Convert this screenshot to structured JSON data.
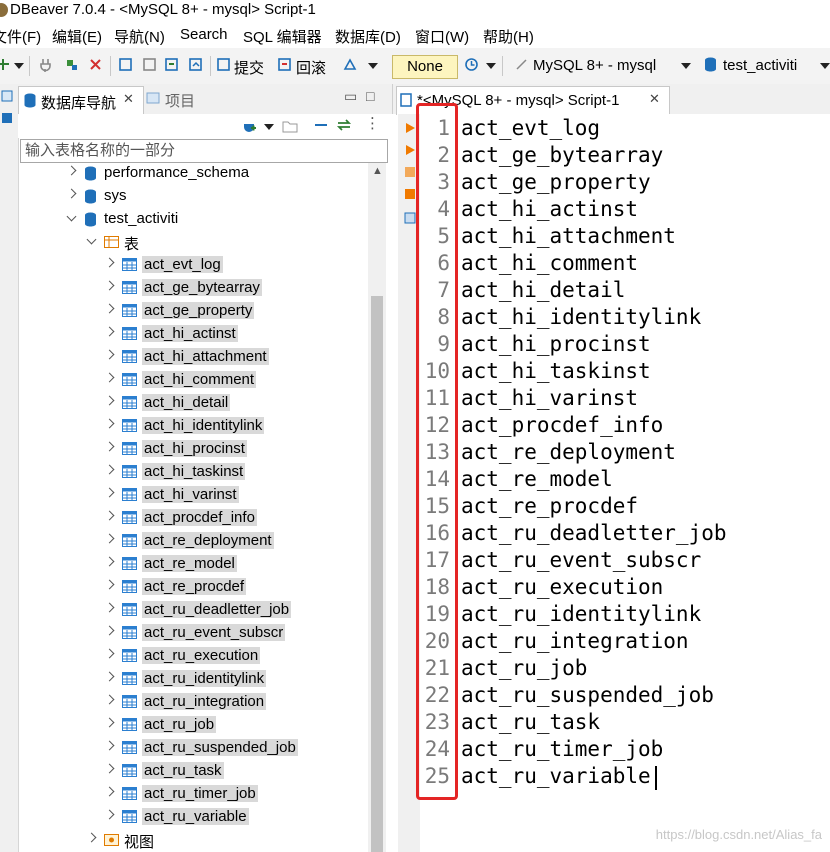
{
  "window": {
    "title": "DBeaver 7.0.4 - <MySQL 8+ - mysql> Script-1"
  },
  "menu": [
    "文件(F)",
    "编辑(E)",
    "导航(N)",
    "Search",
    "SQL 编辑器",
    "数据库(D)",
    "窗口(W)",
    "帮助(H)"
  ],
  "toolbar": {
    "commit_label": "提交",
    "rollback_label": "回滚",
    "transaction_mode": "None",
    "connection": "MySQL 8+ - mysql",
    "schema": "test_activiti"
  },
  "navigator": {
    "tab_active": "数据库导航",
    "tab_inactive": "项目",
    "filter_placeholder": "输入表格名称的一部分",
    "schemas": [
      "performance_schema",
      "sys",
      "test_activiti"
    ],
    "tables_folder": "表",
    "tables": [
      "act_evt_log",
      "act_ge_bytearray",
      "act_ge_property",
      "act_hi_actinst",
      "act_hi_attachment",
      "act_hi_comment",
      "act_hi_detail",
      "act_hi_identitylink",
      "act_hi_procinst",
      "act_hi_taskinst",
      "act_hi_varinst",
      "act_procdef_info",
      "act_re_deployment",
      "act_re_model",
      "act_re_procdef",
      "act_ru_deadletter_job",
      "act_ru_event_subscr",
      "act_ru_execution",
      "act_ru_identitylink",
      "act_ru_integration",
      "act_ru_job",
      "act_ru_suspended_job",
      "act_ru_task",
      "act_ru_timer_job",
      "act_ru_variable"
    ],
    "views_folder": "视图"
  },
  "editor": {
    "tab_label": "*<MySQL 8+ - mysql> Script-1",
    "lines": [
      "act_evt_log",
      "act_ge_bytearray",
      "act_ge_property",
      "act_hi_actinst",
      "act_hi_attachment",
      "act_hi_comment",
      "act_hi_detail",
      "act_hi_identitylink",
      "act_hi_procinst",
      "act_hi_taskinst",
      "act_hi_varinst",
      "act_procdef_info",
      "act_re_deployment",
      "act_re_model",
      "act_re_procdef",
      "act_ru_deadletter_job",
      "act_ru_event_subscr",
      "act_ru_execution",
      "act_ru_identitylink",
      "act_ru_integration",
      "act_ru_job",
      "act_ru_suspended_job",
      "act_ru_task",
      "act_ru_timer_job",
      "act_ru_variable"
    ]
  },
  "watermark": "https://blog.csdn.net/Alias_fa",
  "colors": {
    "highlight_box": "#e42525",
    "db_icon": "#1f6fb8",
    "table_icon": "#2b7fd0"
  }
}
